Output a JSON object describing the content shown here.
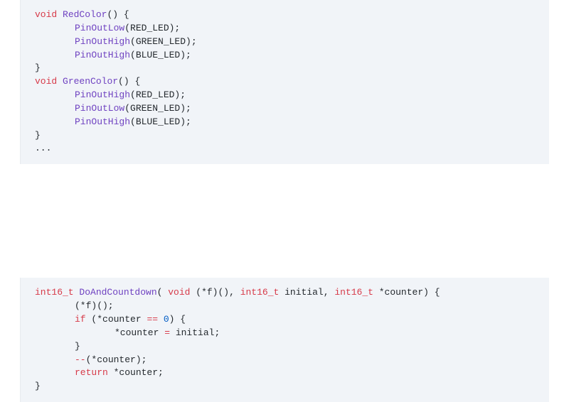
{
  "block1": {
    "l1_kw": "void",
    "l1_fn": "RedColor",
    "l1_rest": "() {",
    "l2_fn": "PinOutLow",
    "l2_arg": "(RED_LED);",
    "l3_fn": "PinOutHigh",
    "l3_arg": "(GREEN_LED);",
    "l4_fn": "PinOutHigh",
    "l4_arg": "(BLUE_LED);",
    "l5": "}",
    "l6_kw": "void",
    "l6_fn": "GreenColor",
    "l6_rest": "() {",
    "l7_fn": "PinOutHigh",
    "l7_arg": "(RED_LED);",
    "l8_fn": "PinOutLow",
    "l8_arg": "(GREEN_LED);",
    "l9_fn": "PinOutHigh",
    "l9_arg": "(BLUE_LED);",
    "l10": "}",
    "l11": "..."
  },
  "block2": {
    "l1_type1": "int16_t",
    "l1_fn": "DoAndCountdown",
    "l1_p1": "( ",
    "l1_kw": "void",
    "l1_p2": " (*f)(), ",
    "l1_type2": "int16_t",
    "l1_p3": " initial, ",
    "l1_type3": "int16_t",
    "l1_p4": " *counter) {",
    "l2": "(*f)();",
    "l3_kw": "if",
    "l3_rest1": " (*counter ",
    "l3_op": "==",
    "l3_rest2": " ",
    "l3_num": "0",
    "l3_rest3": ") {",
    "l4_pre": "*counter ",
    "l4_op": "=",
    "l4_post": " initial;",
    "l5": "}",
    "l6_op": "--",
    "l6_rest": "(*counter);",
    "l7_kw": "return",
    "l7_rest": " *counter;",
    "l8": "}"
  }
}
